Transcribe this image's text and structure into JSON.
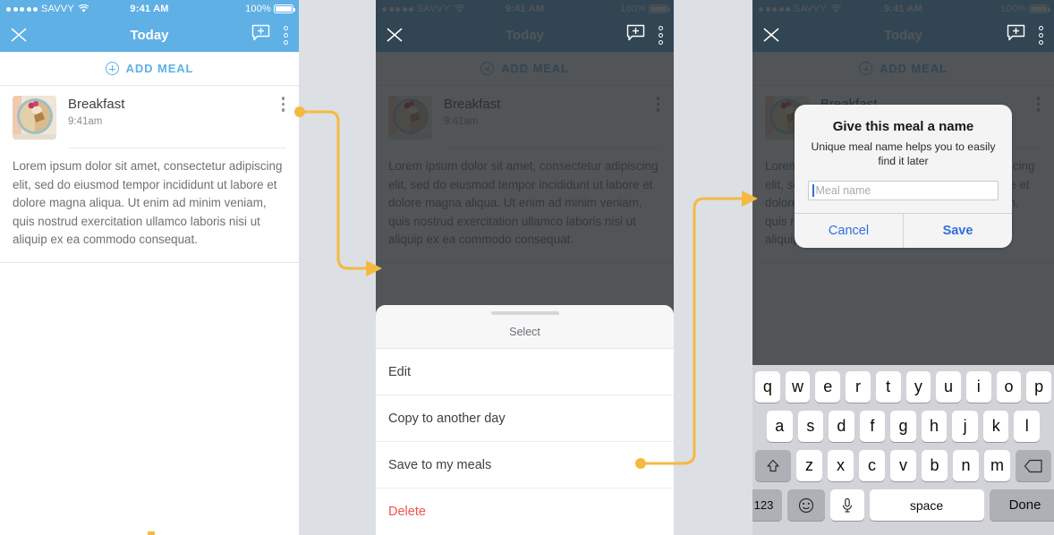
{
  "colors": {
    "brand_blue": "#5FB0E5",
    "ios_blue": "#2f6fe0",
    "accent_orange": "#F5B942",
    "danger_red": "#ef5350",
    "gap_background": "#dcdfe4",
    "dim_overlay": "rgba(38,42,46,0.80)"
  },
  "status_bar": {
    "carrier": "SAVVY",
    "signal_dots": 5,
    "wifi_icon": "wifi-icon",
    "time": "9:41 AM",
    "battery_percent": "100%",
    "battery_icon": "battery-full-icon"
  },
  "nav_bar": {
    "close_icon": "close-x-icon",
    "title": "Today",
    "comment_add_icon": "comment-add-icon",
    "overflow_icon": "kebab-menu-icon"
  },
  "add_meal": {
    "label": "ADD MEAL",
    "icon": "plus-circle-icon"
  },
  "meal_card": {
    "thumbnail_icon": "oatmeal-bowl-photo",
    "title": "Breakfast",
    "time": "9:41am",
    "overflow_icon": "kebab-menu-icon",
    "body": "Lorem ipsum dolor sit amet, consectetur adipiscing elit, sed do eiusmod tempor incididunt ut labore et dolore magna aliqua. Ut enim ad minim veniam, quis nostrud exercitation ullamco laboris nisi ut aliquip ex ea commodo consequat."
  },
  "action_sheet": {
    "grabber_icon": "drag-handle-icon",
    "title": "Select",
    "items": [
      {
        "label": "Edit",
        "style": "default"
      },
      {
        "label": "Copy to another day",
        "style": "default"
      },
      {
        "label": "Save to my meals",
        "style": "default"
      },
      {
        "label": "Delete",
        "style": "danger"
      }
    ]
  },
  "alert": {
    "title": "Give this meal a name",
    "message": "Unique meal name helps you to easily find it later",
    "input_value": "",
    "input_placeholder": "Meal name",
    "cancel_label": "Cancel",
    "save_label": "Save"
  },
  "keyboard": {
    "row1": [
      "q",
      "w",
      "e",
      "r",
      "t",
      "y",
      "u",
      "i",
      "o",
      "p"
    ],
    "row2": [
      "a",
      "s",
      "d",
      "f",
      "g",
      "h",
      "j",
      "k",
      "l"
    ],
    "row3": [
      "z",
      "x",
      "c",
      "v",
      "b",
      "n",
      "m"
    ],
    "shift_icon": "shift-up-arrow-icon",
    "backspace_icon": "backspace-icon",
    "numbers_label": "123",
    "emoji_icon": "smiley-face-icon",
    "mic_icon": "microphone-icon",
    "space_label": "space",
    "done_label": "Done"
  },
  "connectors": {
    "arrow1_name": "flow-arrow-card-menu-to-sheet",
    "arrow2_name": "flow-arrow-save-to-my-meals-to-dialog"
  }
}
